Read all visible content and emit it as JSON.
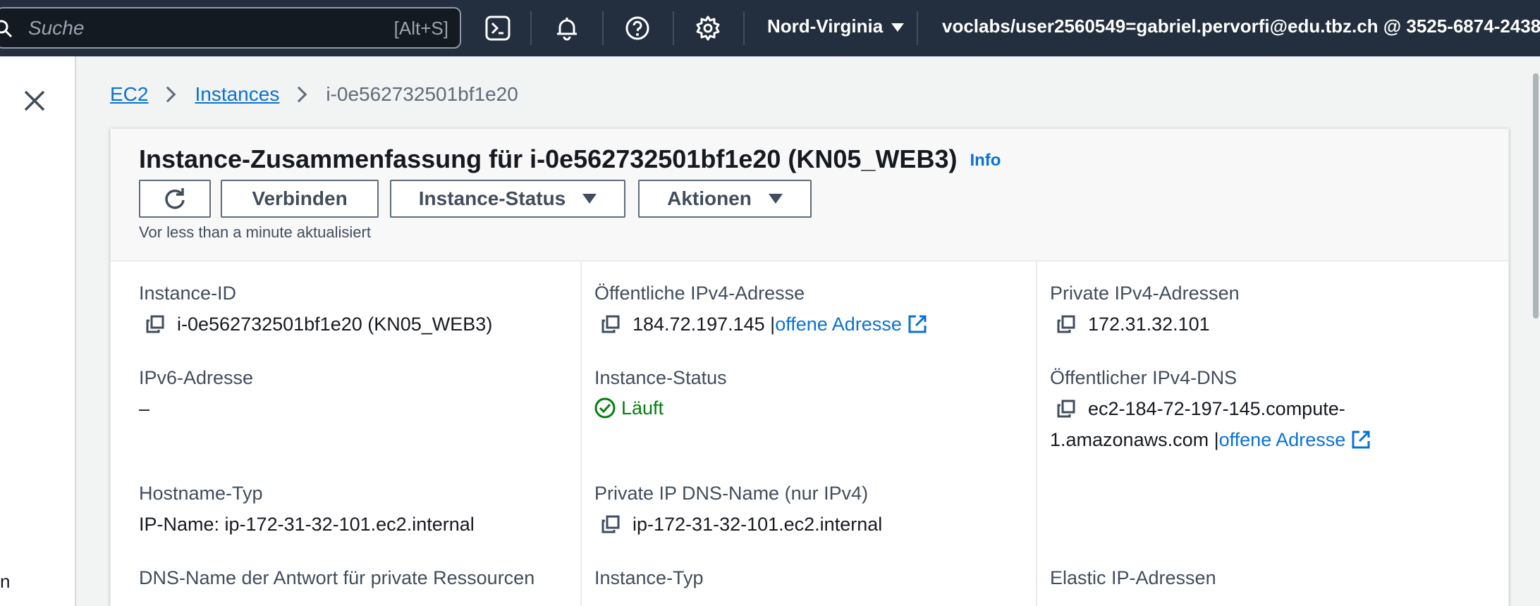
{
  "topbar": {
    "search_placeholder": "Suche",
    "search_shortcut": "[Alt+S]",
    "region": "Nord-Virginia",
    "account": "voclabs/user2560549=gabriel.pervorfi@edu.tbz.ch @ 3525-6874-2438",
    "icons": [
      "cloudshell-icon",
      "bell-icon",
      "help-icon",
      "gear-icon"
    ]
  },
  "siderail": {
    "fragment": "n"
  },
  "breadcrumb": {
    "items": [
      "EC2",
      "Instances",
      "i-0e562732501bf1e20"
    ]
  },
  "summary": {
    "title": "Instance-Zusammenfassung für i-0e562732501bf1e20 (KN05_WEB3)",
    "info": "Info",
    "buttons": {
      "connect": "Verbinden",
      "instance_status": "Instance-Status",
      "actions": "Aktionen"
    },
    "updated": "Vor less than a minute aktualisiert"
  },
  "details": {
    "instance_id": {
      "label": "Instance-ID",
      "value": "i-0e562732501bf1e20 (KN05_WEB3)"
    },
    "public_ipv4": {
      "label": "Öffentliche IPv4-Adresse",
      "value": "184.72.197.145 |",
      "link": "offene Adresse"
    },
    "private_ipv4": {
      "label": "Private IPv4-Adressen",
      "value": "172.31.32.101"
    },
    "ipv6": {
      "label": "IPv6-Adresse",
      "value": "–"
    },
    "instance_state": {
      "label": "Instance-Status",
      "value": "Läuft"
    },
    "public_dns": {
      "label": "Öffentlicher IPv4-DNS",
      "value_line1": "ec2-184-72-197-145.compute-",
      "value_line2": "1.amazonaws.com |",
      "link": "offene Adresse"
    },
    "hostname_type": {
      "label": "Hostname-Typ",
      "value": "IP-Name: ip-172-31-32-101.ec2.internal"
    },
    "private_dns": {
      "label": "Private IP DNS-Name (nur IPv4)",
      "value": "ip-172-31-32-101.ec2.internal"
    },
    "resource_dns": {
      "label": "DNS-Name der Antwort für private Ressourcen"
    },
    "instance_type": {
      "label": "Instance-Typ"
    },
    "elastic_ip": {
      "label": "Elastic IP-Adressen"
    }
  },
  "colors": {
    "nav_bg": "#232f3e",
    "link": "#0972d3",
    "success": "#037f0c",
    "text": "#16191f"
  }
}
